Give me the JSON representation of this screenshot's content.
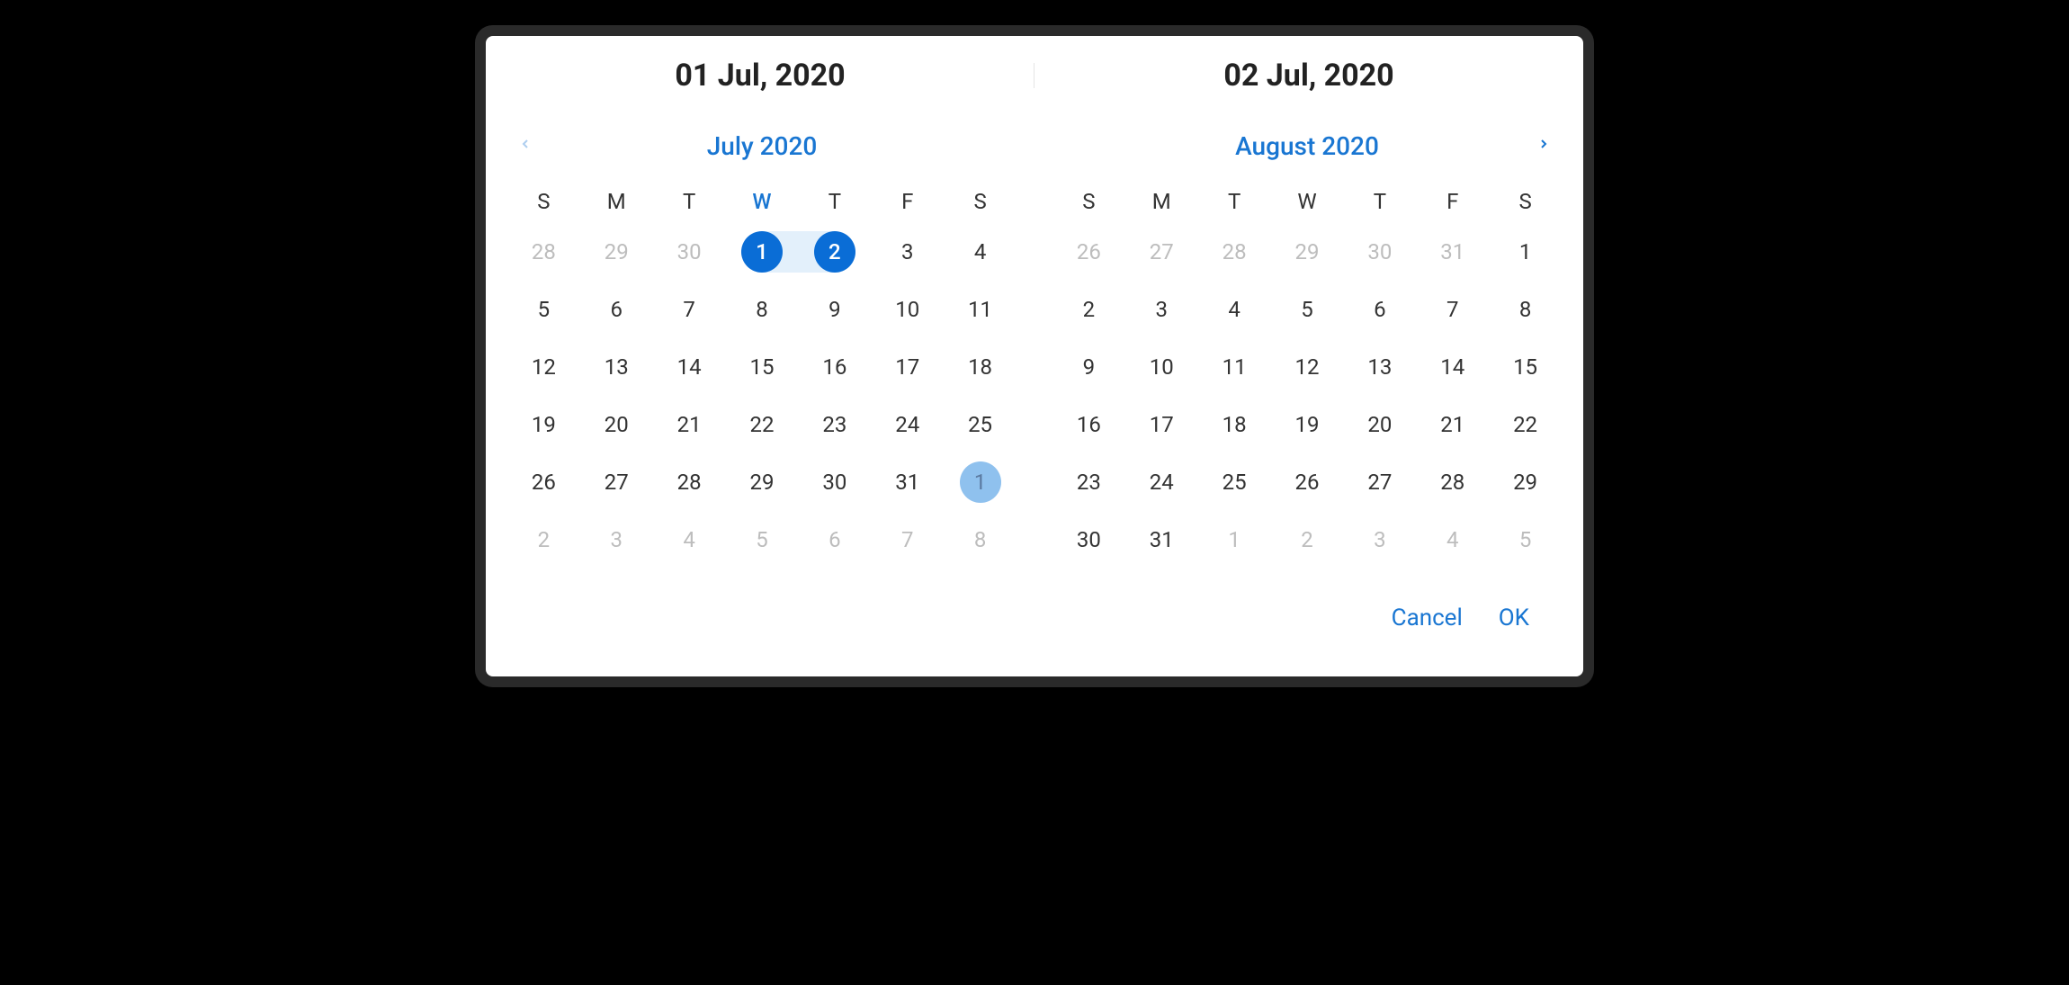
{
  "colors": {
    "accent": "#1976d2",
    "selected": "#0a6dd6",
    "hover": "#8fc1ee",
    "range_bg": "#e3f0fb"
  },
  "header": {
    "start": "01 Jul, 2020",
    "end": "02 Jul, 2020"
  },
  "dow": [
    "S",
    "M",
    "T",
    "W",
    "T",
    "F",
    "S"
  ],
  "leftMonth": {
    "label": "July 2020",
    "activeDowIndex": 3,
    "days": [
      {
        "n": 28,
        "out": true
      },
      {
        "n": 29,
        "out": true
      },
      {
        "n": 30,
        "out": true
      },
      {
        "n": 1,
        "sel": true,
        "rangeLeft": true
      },
      {
        "n": 2,
        "sel": true,
        "rangeRight": true
      },
      {
        "n": 3
      },
      {
        "n": 4
      },
      {
        "n": 5
      },
      {
        "n": 6
      },
      {
        "n": 7
      },
      {
        "n": 8
      },
      {
        "n": 9
      },
      {
        "n": 10
      },
      {
        "n": 11
      },
      {
        "n": 12
      },
      {
        "n": 13
      },
      {
        "n": 14
      },
      {
        "n": 15
      },
      {
        "n": 16
      },
      {
        "n": 17
      },
      {
        "n": 18
      },
      {
        "n": 19
      },
      {
        "n": 20
      },
      {
        "n": 21
      },
      {
        "n": 22
      },
      {
        "n": 23
      },
      {
        "n": 24
      },
      {
        "n": 25
      },
      {
        "n": 26
      },
      {
        "n": 27
      },
      {
        "n": 28
      },
      {
        "n": 29
      },
      {
        "n": 30
      },
      {
        "n": 31
      },
      {
        "n": 1,
        "out": true,
        "hover": true
      },
      {
        "n": 2,
        "out": true
      },
      {
        "n": 3,
        "out": true
      },
      {
        "n": 4,
        "out": true
      },
      {
        "n": 5,
        "out": true
      },
      {
        "n": 6,
        "out": true
      },
      {
        "n": 7,
        "out": true
      },
      {
        "n": 8,
        "out": true
      }
    ]
  },
  "rightMonth": {
    "label": "August 2020",
    "activeDowIndex": -1,
    "days": [
      {
        "n": 26,
        "out": true
      },
      {
        "n": 27,
        "out": true
      },
      {
        "n": 28,
        "out": true
      },
      {
        "n": 29,
        "out": true
      },
      {
        "n": 30,
        "out": true
      },
      {
        "n": 31,
        "out": true
      },
      {
        "n": 1
      },
      {
        "n": 2
      },
      {
        "n": 3
      },
      {
        "n": 4
      },
      {
        "n": 5
      },
      {
        "n": 6
      },
      {
        "n": 7
      },
      {
        "n": 8
      },
      {
        "n": 9
      },
      {
        "n": 10
      },
      {
        "n": 11
      },
      {
        "n": 12
      },
      {
        "n": 13
      },
      {
        "n": 14
      },
      {
        "n": 15
      },
      {
        "n": 16
      },
      {
        "n": 17
      },
      {
        "n": 18
      },
      {
        "n": 19
      },
      {
        "n": 20
      },
      {
        "n": 21
      },
      {
        "n": 22
      },
      {
        "n": 23
      },
      {
        "n": 24
      },
      {
        "n": 25
      },
      {
        "n": 26
      },
      {
        "n": 27
      },
      {
        "n": 28
      },
      {
        "n": 29
      },
      {
        "n": 30
      },
      {
        "n": 31
      },
      {
        "n": 1,
        "out": true
      },
      {
        "n": 2,
        "out": true
      },
      {
        "n": 3,
        "out": true
      },
      {
        "n": 4,
        "out": true
      },
      {
        "n": 5,
        "out": true
      }
    ]
  },
  "footer": {
    "cancel": "Cancel",
    "ok": "OK"
  }
}
